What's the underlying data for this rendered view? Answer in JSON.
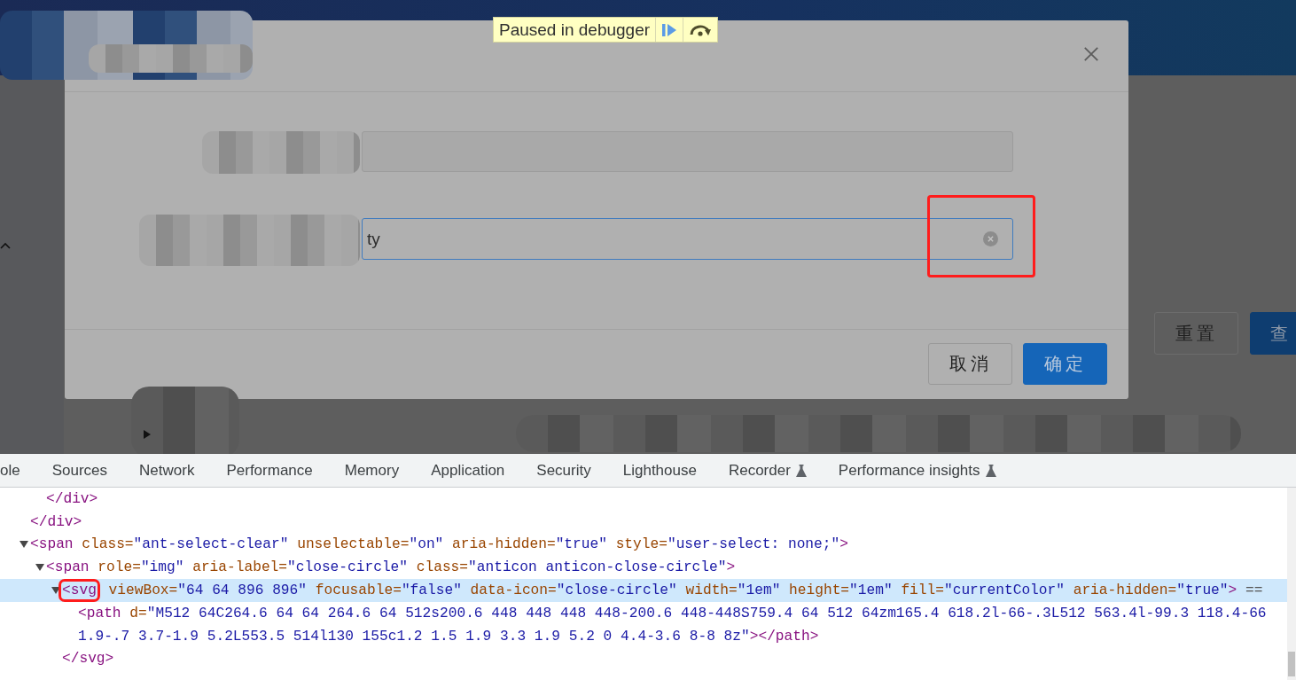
{
  "debugger_banner": {
    "text": "Paused in debugger"
  },
  "background_page": {
    "buttons": [
      {
        "label": "重置",
        "primary": false
      },
      {
        "label": "查",
        "primary": true
      }
    ]
  },
  "modal": {
    "fields": [
      {
        "kind": "input",
        "disabled": true
      },
      {
        "kind": "select",
        "focused": true,
        "value": "ty",
        "clearable": true
      }
    ],
    "buttons": [
      {
        "label": "取消",
        "primary": false
      },
      {
        "label": "确定",
        "primary": true
      }
    ]
  },
  "devtools": {
    "tabs": [
      {
        "label": "ole",
        "experimental": false
      },
      {
        "label": "Sources",
        "experimental": false
      },
      {
        "label": "Network",
        "experimental": false
      },
      {
        "label": "Performance",
        "experimental": false
      },
      {
        "label": "Memory",
        "experimental": false
      },
      {
        "label": "Application",
        "experimental": false
      },
      {
        "label": "Security",
        "experimental": false
      },
      {
        "label": "Lighthouse",
        "experimental": false
      },
      {
        "label": "Recorder",
        "experimental": true
      },
      {
        "label": "Performance insights",
        "experimental": true
      }
    ],
    "elements": [
      {
        "children": [
          {
            "selected": false,
            "lines": [
              [
                {
                  "kind": "tag",
                  "text": "</div>"
                }
              ]
            ]
          }
        ]
      },
      {
        "selected": false,
        "lines": [
          [
            {
              "kind": "tag",
              "text": "</div>"
            }
          ]
        ]
      },
      {
        "selected": false,
        "expanded": true,
        "lines": [
          [
            {
              "kind": "tag",
              "text": "<span"
            },
            {
              "kind": "attr-name",
              "text": "class="
            },
            {
              "kind": "attr-value",
              "text": "\"ant-select-clear\""
            },
            {
              "kind": "attr-name",
              "text": "unselectable="
            },
            {
              "kind": "attr-value",
              "text": "\"on\""
            },
            {
              "kind": "attr-name",
              "text": "aria-hidden="
            },
            {
              "kind": "attr-value",
              "text": "\"true\""
            },
            {
              "kind": "attr-name",
              "text": "style="
            },
            {
              "kind": "attr-value",
              "text": "\"user-select: none;\""
            },
            {
              "kind": "tag",
              "text": ">"
            }
          ]
        ],
        "children": [
          {
            "selected": false,
            "expanded": true,
            "lines": [
              [
                {
                  "kind": "tag",
                  "text": "<span"
                },
                {
                  "kind": "attr-name",
                  "text": "role="
                },
                {
                  "kind": "attr-value",
                  "text": "\"img\""
                },
                {
                  "kind": "attr-name",
                  "text": "aria-label="
                },
                {
                  "kind": "attr-value",
                  "text": "\"close-circle\""
                },
                {
                  "kind": "attr-name",
                  "text": "class="
                },
                {
                  "kind": "attr-value",
                  "text": "\"anticon anticon-close-circle\""
                },
                {
                  "kind": "tag",
                  "text": ">"
                }
              ]
            ],
            "children": [
              {
                "selected": true,
                "expanded": true,
                "lines": [
                  [
                    {
                      "kind": "tag",
                      "text": "<svg",
                      "annotated": true
                    },
                    {
                      "kind": "attr-name",
                      "text": "viewBox="
                    },
                    {
                      "kind": "attr-value",
                      "text": "\"64 64 896 896\""
                    },
                    {
                      "kind": "attr-name",
                      "text": "focusable="
                    },
                    {
                      "kind": "attr-value",
                      "text": "\"false\""
                    },
                    {
                      "kind": "attr-name",
                      "text": "data-icon="
                    },
                    {
                      "kind": "attr-value",
                      "text": "\"close-circle\""
                    },
                    {
                      "kind": "attr-name",
                      "text": "width="
                    },
                    {
                      "kind": "attr-value",
                      "text": "\"1em\""
                    },
                    {
                      "kind": "attr-name",
                      "text": "height="
                    },
                    {
                      "kind": "attr-value",
                      "text": "\"1em\""
                    },
                    {
                      "kind": "attr-name",
                      "text": "fill="
                    },
                    {
                      "kind": "attr-value",
                      "text": "\"currentColor\""
                    },
                    {
                      "kind": "attr-name",
                      "text": "aria-hidden="
                    },
                    {
                      "kind": "attr-value",
                      "text": "\"true\""
                    },
                    {
                      "kind": "tag",
                      "text": ">"
                    },
                    {
                      "kind": "marker",
                      "text": "=="
                    }
                  ]
                ],
                "children": [
                  {
                    "selected": false,
                    "lines": [
                      [
                        {
                          "kind": "tag",
                          "text": "<path"
                        },
                        {
                          "kind": "attr-name",
                          "text": "d="
                        },
                        {
                          "kind": "attr-value",
                          "text": "\"M512 64C264.6 64 64 264.6 64 512s200.6 448 448 448 448-200.6 448-448S759.4 64 512 64zm165.4 618.2l-66-.3L512 563.4l-99.3 118.4-66"
                        }
                      ],
                      [
                        {
                          "kind": "attr-value",
                          "text": "1.9-.7 3.7-1.9 5.2L553.5 514l130 155c1.2 1.5 1.9 3.3 1.9 5.2 0 4.4-3.6 8-8 8z\""
                        },
                        {
                          "kind": "tag",
                          "text": "></path>"
                        }
                      ]
                    ]
                  }
                ],
                "closing": [
                  {
                    "kind": "tag",
                    "text": "</svg>"
                  }
                ]
              }
            ]
          }
        ]
      }
    ]
  }
}
